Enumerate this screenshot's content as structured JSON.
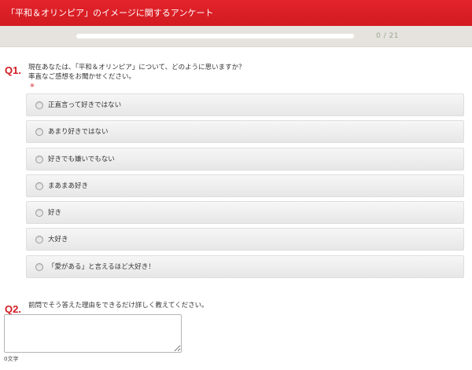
{
  "header": {
    "title": "「平和＆オリンピア」のイメージに関するアンケート"
  },
  "progress": {
    "current": 0,
    "total": 21,
    "label": "0 / 21"
  },
  "questions": {
    "q1": {
      "number": "Q1.",
      "text_line1": "現在あなたは、「平和＆オリンピア」について、どのように思いますか？",
      "text_line2": "率直なご感想をお聞かせください。",
      "required_mark": "※",
      "options": [
        {
          "label": "正直言って好きではない"
        },
        {
          "label": "あまり好きではない"
        },
        {
          "label": "好きでも嫌いでもない"
        },
        {
          "label": "まあまあ好き"
        },
        {
          "label": "好き"
        },
        {
          "label": "大好き"
        },
        {
          "label": "「愛がある」と言えるほど大好き！"
        }
      ]
    },
    "q2": {
      "number": "Q2.",
      "text": "前問でそう答えた理由をできるだけ詳しく教えてください。",
      "answer_value": "",
      "char_count": "0文字"
    }
  },
  "colors": {
    "accent": "#d21a21",
    "band": "#e6e3de"
  }
}
